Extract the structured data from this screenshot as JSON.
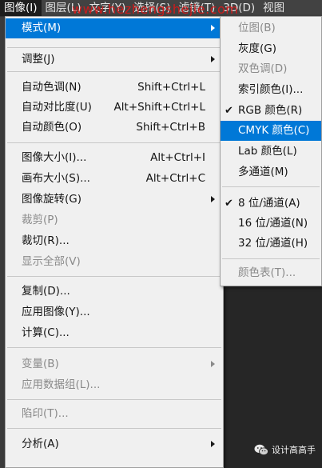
{
  "menubar": {
    "items": [
      "图像(I)",
      "图层(L)",
      "文字(Y)",
      "选择(S)",
      "滤镜(T)",
      "3D(D)",
      "视图"
    ],
    "active_index": 0
  },
  "watermark": "www.hezhengshejie.com",
  "menu": {
    "items": [
      {
        "label": "模式(M)",
        "submenu": true,
        "highlighted": true
      },
      {
        "label": "调整(J)",
        "submenu": true
      },
      {
        "label": "自动色调(N)",
        "shortcut": "Shift+Ctrl+L"
      },
      {
        "label": "自动对比度(U)",
        "shortcut": "Alt+Shift+Ctrl+L"
      },
      {
        "label": "自动颜色(O)",
        "shortcut": "Shift+Ctrl+B"
      },
      {
        "label": "图像大小(I)...",
        "shortcut": "Alt+Ctrl+I"
      },
      {
        "label": "画布大小(S)...",
        "shortcut": "Alt+Ctrl+C"
      },
      {
        "label": "图像旋转(G)",
        "submenu": true
      },
      {
        "label": "裁剪(P)",
        "disabled": true
      },
      {
        "label": "裁切(R)..."
      },
      {
        "label": "显示全部(V)",
        "disabled": true
      },
      {
        "label": "复制(D)..."
      },
      {
        "label": "应用图像(Y)..."
      },
      {
        "label": "计算(C)..."
      },
      {
        "label": "变量(B)",
        "submenu": true,
        "disabled": true
      },
      {
        "label": "应用数据组(L)...",
        "disabled": true
      },
      {
        "label": "陷印(T)...",
        "disabled": true
      },
      {
        "label": "分析(A)",
        "submenu": true
      }
    ]
  },
  "submenu": {
    "items": [
      {
        "label": "位图(B)",
        "disabled": true
      },
      {
        "label": "灰度(G)"
      },
      {
        "label": "双色调(D)",
        "disabled": true
      },
      {
        "label": "索引颜色(I)..."
      },
      {
        "label": "RGB 颜色(R)",
        "checked": true
      },
      {
        "label": "CMYK 颜色(C)",
        "highlighted": true
      },
      {
        "label": "Lab 颜色(L)"
      },
      {
        "label": "多通道(M)"
      },
      {
        "label": "8 位/通道(A)",
        "checked": true
      },
      {
        "label": "16 位/通道(N)"
      },
      {
        "label": "32 位/通道(H)"
      },
      {
        "label": "颜色表(T)...",
        "disabled": true
      }
    ],
    "check_glyph": "✔"
  },
  "badge": {
    "text": "设计高高手",
    "icon": "wechat-icon"
  },
  "colors": {
    "highlight": "#0078d7",
    "menu_bg": "#f0f0f0",
    "disabled": "#8a8a8a"
  }
}
